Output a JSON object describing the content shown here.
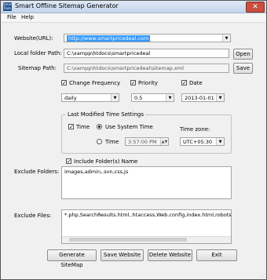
{
  "window": {
    "app_icon_text": "Smart Tools",
    "title": "Smart Offline Sitemap Generator",
    "close_glyph": "✕"
  },
  "menu": {
    "file": "File",
    "help": "Help"
  },
  "website": {
    "label": "Website(URL):",
    "value": "http://www.smartpricedeal.com"
  },
  "local_folder": {
    "label": "Local folder Path:",
    "value": "C:\\xampp\\htdocs\\smartpricedeal",
    "button": "Open"
  },
  "sitemap_path": {
    "label": "Sitemap Path:",
    "value": "C:\\xampp\\htdocs\\smartpricedeal\\sitemap.xml",
    "button": "Save"
  },
  "change_frequency": {
    "label": "Change Frequency",
    "checked": true,
    "value": "daily"
  },
  "priority": {
    "label": "Priority",
    "checked": true,
    "value": "0.5"
  },
  "date": {
    "label": "Date",
    "checked": true,
    "value": "2013-01-01"
  },
  "last_modified": {
    "group_title": "Last Modified Time Settings",
    "time_label": "Time",
    "time_checked": true,
    "use_system_time": "Use System Time",
    "time_radio": "Time",
    "time_value": "3:57:00 PM",
    "timezone_label": "Time zone:",
    "timezone_value": "UTC+05:30"
  },
  "include_folder": {
    "label": "Include Folder(s) Name",
    "checked": true
  },
  "exclude_folders": {
    "label": "Exclude Folders:",
    "value": "images,admin,.svn,css,js"
  },
  "exclude_files": {
    "label": "Exclude Files:",
    "value": "*.php,SearchResults.html,.htaccess,Web.config,index.html,robots.txt,sit"
  },
  "buttons": {
    "generate": "Generate SiteMap",
    "save_website": "Save Website",
    "delete_website": "Delete Website",
    "exit": "Exit"
  }
}
